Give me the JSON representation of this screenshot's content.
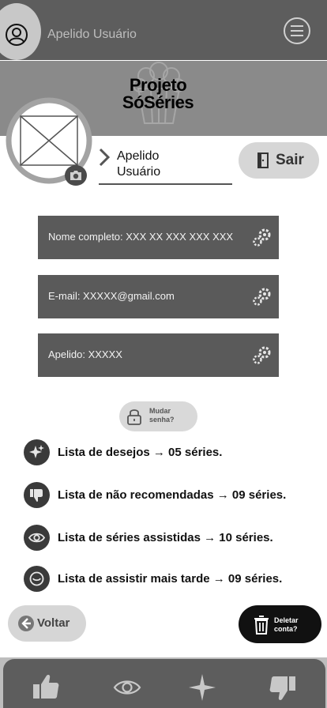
{
  "header": {
    "username": "Apelido Usuário"
  },
  "banner": {
    "brand_line1": "Projeto",
    "brand_line2": "SóSéries"
  },
  "profile": {
    "nickname_line1": "Apelido",
    "nickname_line2": "Usuário",
    "logout_label": "Sair"
  },
  "fields": {
    "full_name": "Nome completo: XXX XX XXX XXX XXX",
    "email": "E-mail: XXXXX@gmail.com",
    "nickname": "Apelido: XXXXX"
  },
  "password": {
    "line1": "Mudar",
    "line2": "senha?"
  },
  "lists": {
    "wishlist": "Lista de desejos →  05 séries.",
    "not_recommended": "Lista de não recomendadas → 09 séries.",
    "watched": "Lista de séries assistidas →  10 séries.",
    "watch_later": "Lista de assistir mais tarde → 09 séries."
  },
  "actions": {
    "back_label": "Voltar",
    "delete_line1": "Deletar",
    "delete_line2": "conta?"
  },
  "colors": {
    "topbar": "#5d5d5d",
    "banner": "#8a8a8a",
    "field": "#5a5a5a",
    "pill": "#d6d6d6",
    "danger_button": "#111111"
  },
  "icons": {
    "header": [
      "user-circle-icon",
      "hamburger-menu-icon"
    ],
    "banner": [
      "popcorn-icon"
    ],
    "profile": [
      "photo-placeholder-icon",
      "camera-icon",
      "chevron-right-icon",
      "door-icon"
    ],
    "fields": [
      "gears-icon"
    ],
    "password": [
      "lock-icon"
    ],
    "lists": [
      "sparkle-icon",
      "thumbs-down-icon",
      "eye-icon",
      "clock-icon"
    ],
    "actions": [
      "arrow-left-icon",
      "trash-icon"
    ],
    "nav": [
      "thumbs-up-icon",
      "eye-icon",
      "sparkle-icon",
      "thumbs-down-icon"
    ]
  }
}
